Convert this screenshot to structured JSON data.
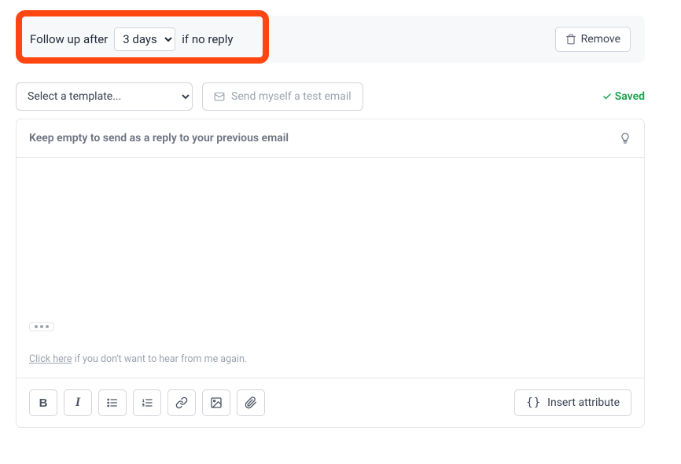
{
  "followup": {
    "before_text": "Follow up after",
    "after_text": "if no reply",
    "selected_delay": "3 days",
    "remove_label": "Remove"
  },
  "template_row": {
    "template_placeholder": "Select a template...",
    "test_email_label": "Send myself a test email",
    "saved_label": "Saved"
  },
  "editor": {
    "subject_placeholder": "Keep empty to send as a reply to your previous email",
    "unsubscribe_link": "Click here",
    "unsubscribe_rest": " if you don't want to hear from me again."
  },
  "toolbar": {
    "insert_attribute_label": "Insert attribute"
  }
}
